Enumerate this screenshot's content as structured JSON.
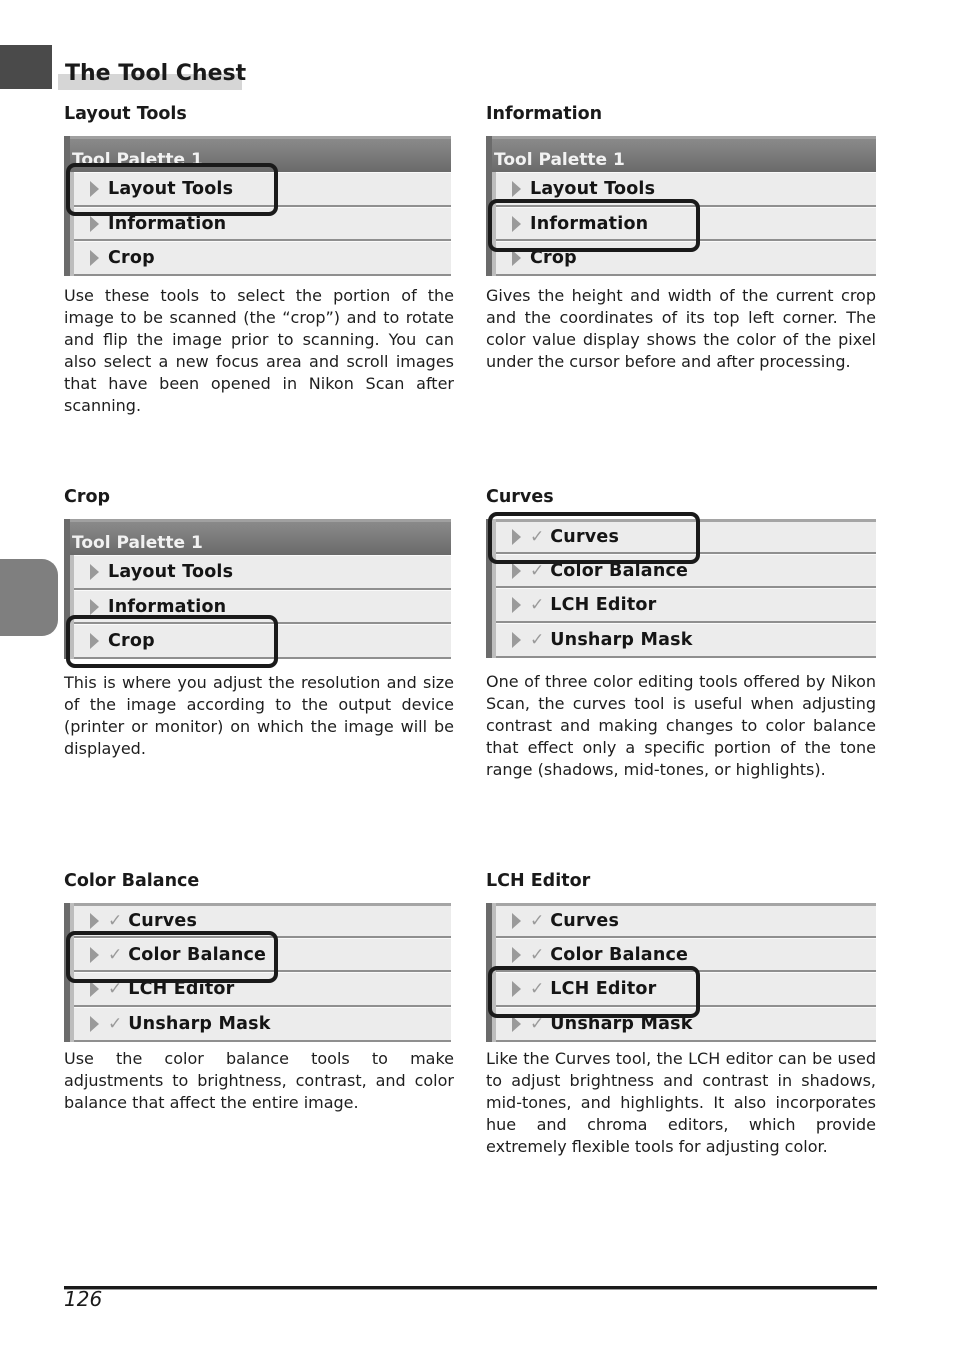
{
  "page": {
    "title": "The Tool Chest",
    "page_number": "126"
  },
  "sections": [
    {
      "heading": "Layout Tools",
      "palette_title": "Tool Palette 1",
      "items": [
        "Layout Tools",
        "Information",
        "Crop"
      ],
      "highlighted": "Layout Tools",
      "description": "Use these tools to select the portion of the image to be scanned (the “crop”) and to rotate and flip the image prior to scanning.  You can also select a new focus area and scroll images that have been opened in Nikon Scan after scanning."
    },
    {
      "heading": "Information",
      "palette_title": "Tool Palette 1",
      "items": [
        "Layout Tools",
        "Information",
        "Crop"
      ],
      "highlighted": "Information",
      "description": "Gives the height and width of the current crop and the coordinates of its top left corner.  The color value display shows the color of the pixel under the cursor before and after processing."
    },
    {
      "heading": "Crop",
      "palette_title": "Tool Palette 1",
      "items": [
        "Layout Tools",
        "Information",
        "Crop"
      ],
      "highlighted": "Crop",
      "description": "This is where you adjust the resolution and size of the image according to the output device (printer or monitor) on which the image will be displayed."
    },
    {
      "heading": "Curves",
      "items": [
        "Curves",
        "Color Balance",
        "LCH Editor",
        "Unsharp Mask"
      ],
      "highlighted": "Curves",
      "description": "One of three color editing tools offered by Nikon Scan, the curves tool is useful when adjusting contrast and making changes to color balance that effect only a specific portion of the tone range (shadows, mid-tones, or highlights)."
    },
    {
      "heading": "Color Balance",
      "items": [
        "Curves",
        "Color Balance",
        "LCH Editor",
        "Unsharp Mask"
      ],
      "highlighted": "Color Balance",
      "description": "Use the color balance tools to make adjustments to brightness, contrast, and color balance that affect the entire image."
    },
    {
      "heading": "LCH Editor",
      "items": [
        "Curves",
        "Color Balance",
        "LCH Editor",
        "Unsharp Mask"
      ],
      "highlighted": "LCH Editor",
      "description": "Like the Curves tool, the LCH editor can be used to adjust brightness and contrast in shadows, mid-tones, and highlights.  It also incorporates hue and chroma editors, which provide extremely flexible tools for adjusting color."
    }
  ],
  "icons": {
    "expand": "triangle-right",
    "enabled": "checkmark"
  },
  "colors": {
    "palette_title_bg": "#7a7a7a",
    "row_bg": "#ececec",
    "highlight_border": "#1a1a1a",
    "thumb_tab": "#4a4a4a",
    "side_tab": "#7f7f7f"
  }
}
